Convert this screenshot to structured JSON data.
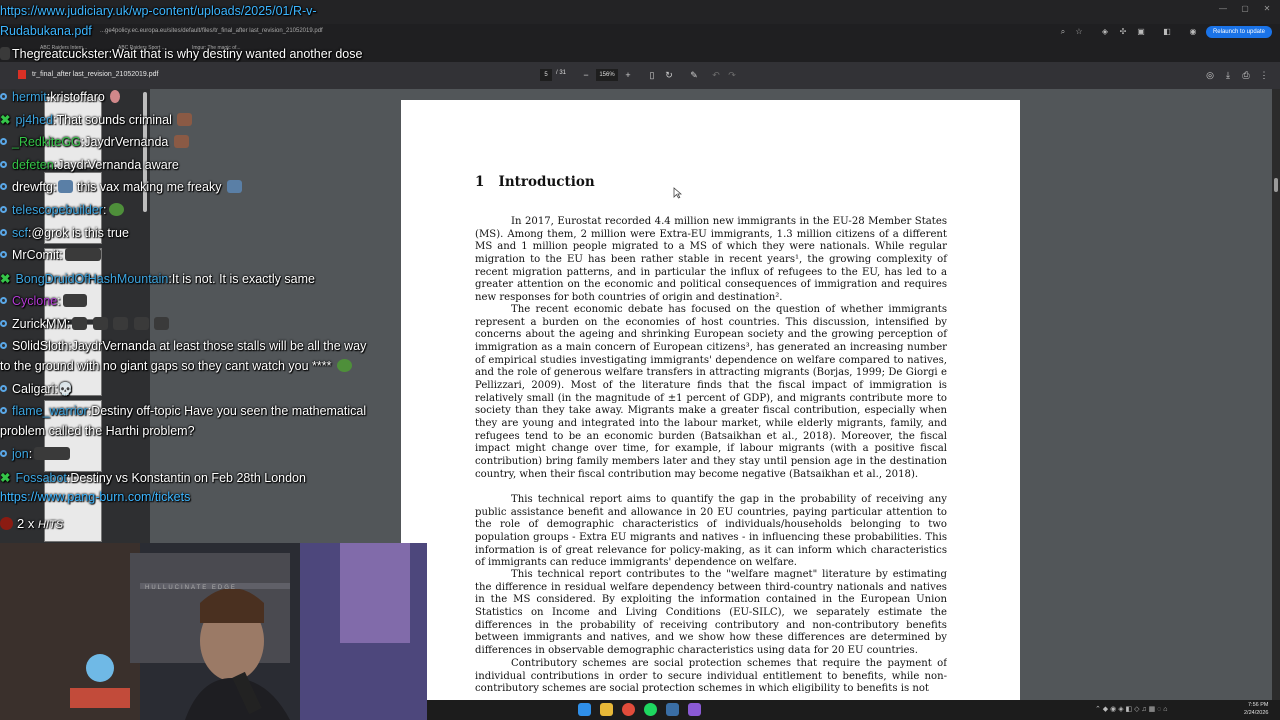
{
  "browser": {
    "address_url": "...ge4policy.ec.europa.eu/sites/default/files/tr_final_after last_revision_21052019.pdf",
    "relaunch_label": "Relaunch to update",
    "bookmarks": [
      "ABC Raiders Intern...",
      "ABC Raiders Sport ...",
      "Imgur: The magic of..."
    ]
  },
  "pdf": {
    "filename": "tr_final_after last_revision_21052019.pdf",
    "current_page": "5",
    "total_pages": "/ 31",
    "zoom": "156%"
  },
  "document": {
    "heading_number": "1",
    "heading": "Introduction",
    "paragraphs": [
      "In 2017, Eurostat recorded 4.4 million new immigrants in the EU-28 Member States (MS). Among them, 2 million were Extra-EU immigrants, 1.3 million citizens of a different MS and 1 million people migrated to a MS of which they were nationals. While regular migration to the EU has been rather stable in recent years¹, the growing complexity of recent migration patterns, and in particular the influx of refugees to the EU, has led to a greater attention on the economic and political consequences of immigration and requires new responses for both countries of origin and destination².",
      "The recent economic debate has focused on the question of whether immigrants represent a burden on the economies of host countries. This discussion, intensified by concerns about the ageing and shrinking European society and the growing perception of immigration as a main concern of European citizens³, has generated an increasing number of empirical studies investigating immigrants' dependence on welfare compared to natives, and the role of generous welfare transfers in attracting migrants (Borjas, 1999; De Giorgi e Pellizzari, 2009). Most of the literature finds that the fiscal impact of immigration is relatively small (in the magnitude of ±1 percent of GDP), and migrants contribute more to society than they take away. Migrants make a greater fiscal contribution, especially when they are young and integrated into the labour market, while elderly migrants, family, and refugees tend to be an economic burden (Batsaikhan et al., 2018). Moreover, the fiscal impact might change over time, for example, if labour migrants (with a positive fiscal contribution) bring family members later and they stay until pension age in the destination country, when their fiscal contribution may become negative (Batsaikhan et al., 2018).",
      "This technical report aims to quantify the gap in the probability of receiving any public assistance benefit and allowance in 20 EU countries, paying particular attention to the role of demographic characteristics of individuals/households belonging to two population groups - Extra EU migrants and natives - in influencing these probabilities. This information is of great relevance for policy-making, as it can inform which characteristics of immigrants can reduce immigrants' dependence on welfare.",
      "This technical report contributes to the \"welfare magnet\" literature by estimating the difference in residual welfare dependency between third-country nationals and natives in the MS considered. By exploiting the information contained in the European Union Statistics on Income and Living Conditions (EU-SILC), we separately estimate the differences in the probability of receiving contributory and non-contributory benefits between immigrants and natives, and we show how these differences are determined by differences in observable demographic characteristics using data for 20 EU countries.",
      "Contributory schemes are social protection schemes that require the payment of individual contributions in order to secure individual entitlement to benefits, while non-contributory schemes are social protection schemes in which eligibility to benefits is not"
    ]
  },
  "chat": {
    "header_url_line1": "https://www.judiciary.uk/wp-content/uploads/2025/01/R-v-",
    "header_url_line2": "Rudabukana.pdf",
    "messages": [
      {
        "user": "Thegreatcuckster",
        "text": "Wait that is why destiny wanted another dose"
      },
      {
        "user": "hermit",
        "text": "kristoffaro"
      },
      {
        "user": "pj4hed",
        "text": "That sounds criminal"
      },
      {
        "user": "_RedkiteGG",
        "text": "JaydrVernanda"
      },
      {
        "user": "defeten",
        "text": "JaydrVernanda aware"
      },
      {
        "user": "drewftg",
        "text": "this vax making me freaky"
      },
      {
        "user": "telescopebuilder",
        "text": ""
      },
      {
        "user": "scf",
        "text": "@grok is this true"
      },
      {
        "user": "MrComit",
        "text": ""
      },
      {
        "user": "BongDruidOfHashMountain",
        "text": "It is not. It is exactly same"
      },
      {
        "user": "Cyclone",
        "text": ""
      },
      {
        "user": "ZurickMM",
        "text": ""
      },
      {
        "user": "S0lidSloth",
        "text": "JaydrVernanda at least those stalls will be all the way",
        "text2": "to the ground with no giant gaps so they cant watch you ****"
      },
      {
        "user": "Caligari",
        "text": ""
      },
      {
        "user": "flame_warrior",
        "text": "Destiny off-topic Have you seen the mathematical",
        "text2": "problem called the Harthi problem?"
      },
      {
        "user": "jon",
        "text": ""
      },
      {
        "user": "Fossabot",
        "text": "Destiny vs Konstantin on Feb 28th London",
        "text2": "https://www.pang-burn.com/tickets"
      }
    ],
    "hits_count": "2 x",
    "hits_label": "HITS"
  },
  "webcam": {
    "poster_text": "HULLUCINATE EDGE"
  },
  "taskbar": {
    "time": "7:56 PM",
    "date": "2/24/2026"
  },
  "colors": {
    "user_blue": "#3da5e0",
    "user_green": "#35c448",
    "user_purple": "#b33ad4",
    "relaunch_blue": "#1a73e8"
  }
}
